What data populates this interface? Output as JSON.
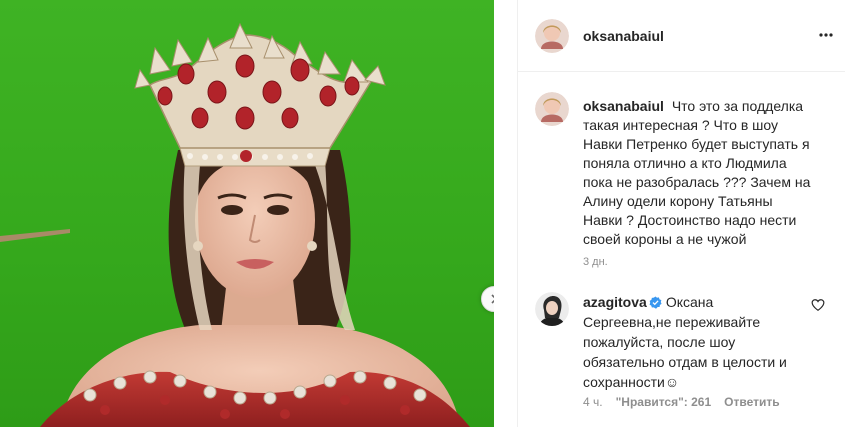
{
  "post": {
    "author": {
      "username": "oksanabaiul",
      "avatar": "avatar-photo"
    },
    "more_icon": "ellipsis-icon",
    "media": {
      "description_icon": "photo-woman-crown",
      "next_icon": "chevron-right-icon"
    },
    "caption": {
      "username": "oksanabaiul",
      "text": "Что это за подделка такая интересная ? Что в шоу Навки Петренко будет выступать я поняла отлично а кто Людмила пока не разобралась ??? Зачем на Алину одели корону Татьяны Навки ? Достоинство надо нести своей короны а не чужой",
      "time": "3 дн."
    },
    "comments": [
      {
        "username": "azagitova",
        "verified": true,
        "text": "Оксана Сергеевна,не переживайте пожалуйста, после шоу обязательно отдам в целости и сохранности☺",
        "time": "4 ч.",
        "likes_label": "\"Нравится\": 261",
        "reply_label": "Ответить",
        "like_icon": "heart-outline-icon"
      }
    ]
  },
  "colors": {
    "green_screen": "#3fb324",
    "verified_blue": "#3897f0",
    "muted_text": "#8e8e8e"
  }
}
